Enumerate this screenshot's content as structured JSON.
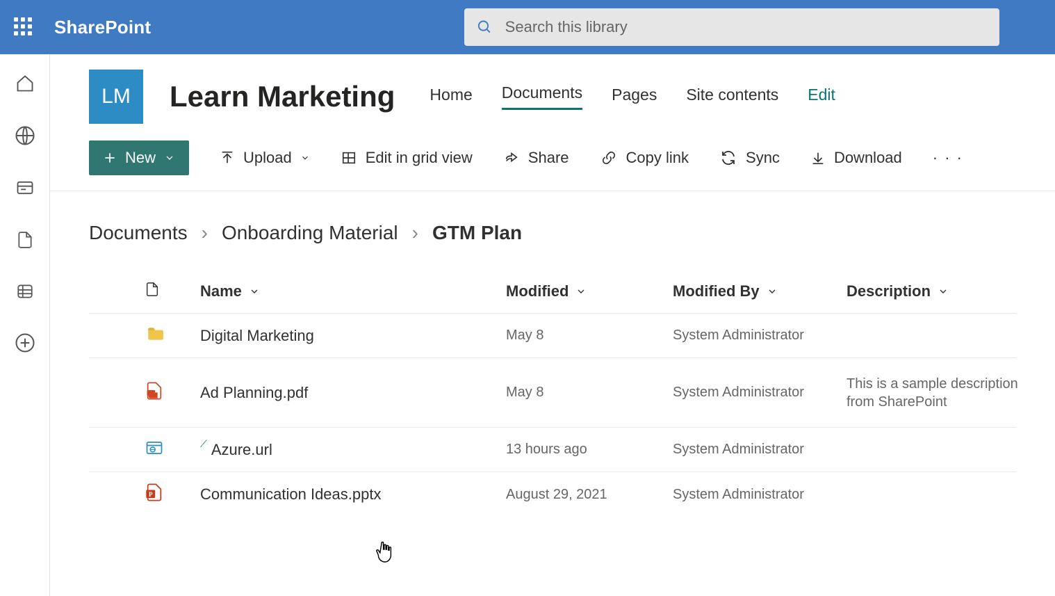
{
  "app_name": "SharePoint",
  "search": {
    "placeholder": "Search this library"
  },
  "site": {
    "logo_text": "LM",
    "title": "Learn Marketing",
    "nav": [
      "Home",
      "Documents",
      "Pages",
      "Site contents",
      "Edit"
    ],
    "active_nav": "Documents"
  },
  "commands": {
    "new": "New",
    "upload": "Upload",
    "edit_grid": "Edit in grid view",
    "share": "Share",
    "copy_link": "Copy link",
    "sync": "Sync",
    "download": "Download"
  },
  "breadcrumb": [
    "Documents",
    "Onboarding Material",
    "GTM Plan"
  ],
  "columns": {
    "name": "Name",
    "modified": "Modified",
    "modified_by": "Modified By",
    "description": "Description"
  },
  "rows": [
    {
      "type": "folder",
      "name": "Digital Marketing",
      "modified": "May 8",
      "modified_by": "System Administrator",
      "description": ""
    },
    {
      "type": "pdf",
      "name": "Ad Planning.pdf",
      "modified": "May 8",
      "modified_by": "System Administrator",
      "description": "This is a sample description from SharePoint"
    },
    {
      "type": "url",
      "name": "Azure.url",
      "modified": "13 hours ago",
      "modified_by": "System Administrator",
      "description": "",
      "new": true
    },
    {
      "type": "pptx",
      "name": "Communication Ideas.pptx",
      "modified": "August 29, 2021",
      "modified_by": "System Administrator",
      "description": ""
    }
  ]
}
